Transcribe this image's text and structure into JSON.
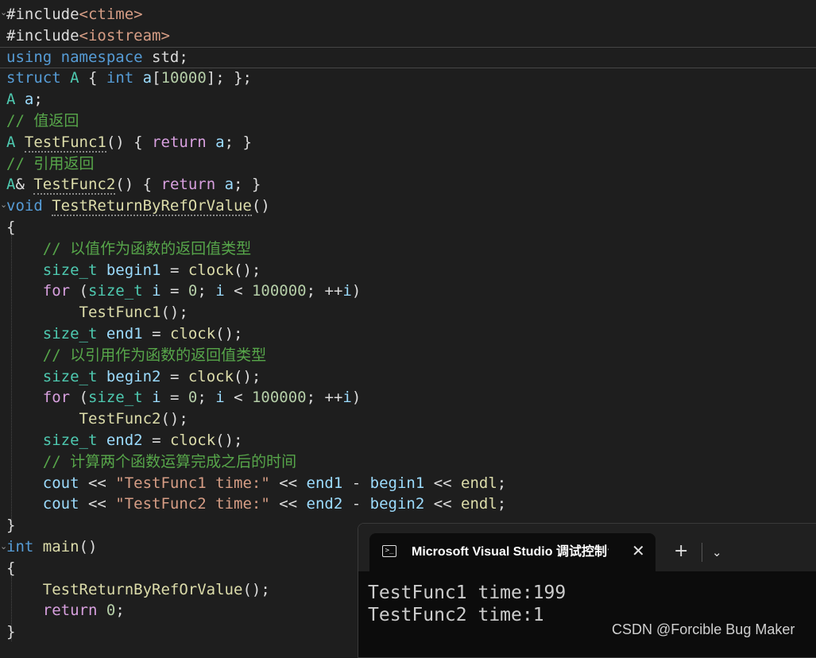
{
  "code": [
    {
      "t": [
        [
          "pl",
          "#include"
        ],
        [
          "str",
          "<ctime>"
        ]
      ]
    },
    {
      "t": [
        [
          "pl",
          "#include"
        ],
        [
          "str",
          "<iostream>"
        ]
      ]
    },
    {
      "t": [
        [
          "kw",
          "using"
        ],
        [
          "pl",
          " "
        ],
        [
          "kw",
          "namespace"
        ],
        [
          "pl",
          " std;"
        ]
      ]
    },
    {
      "t": [
        [
          "kw",
          "struct"
        ],
        [
          "pl",
          " "
        ],
        [
          "ty",
          "A"
        ],
        [
          "pl",
          " { "
        ],
        [
          "kw",
          "int"
        ],
        [
          "pl",
          " "
        ],
        [
          "var",
          "a"
        ],
        [
          "pl",
          "["
        ],
        [
          "num",
          "10000"
        ],
        [
          "pl",
          "]; };"
        ]
      ]
    },
    {
      "t": [
        [
          "ty",
          "A"
        ],
        [
          "pl",
          " "
        ],
        [
          "var",
          "a"
        ],
        [
          "pl",
          ";"
        ]
      ]
    },
    {
      "t": [
        [
          "cm",
          "// 值返回"
        ]
      ]
    },
    {
      "t": [
        [
          "ty",
          "A"
        ],
        [
          "pl",
          " "
        ],
        [
          "fn",
          "TestFunc1"
        ],
        [
          "pl",
          "() { "
        ],
        [
          "kwp",
          "return"
        ],
        [
          "pl",
          " "
        ],
        [
          "var",
          "a"
        ],
        [
          "pl",
          "; }"
        ]
      ]
    },
    {
      "t": [
        [
          "cm",
          "// 引用返回"
        ]
      ]
    },
    {
      "t": [
        [
          "ty",
          "A"
        ],
        [
          "pl",
          "& "
        ],
        [
          "fn",
          "TestFunc2"
        ],
        [
          "pl",
          "() { "
        ],
        [
          "kwp",
          "return"
        ],
        [
          "pl",
          " "
        ],
        [
          "var",
          "a"
        ],
        [
          "pl",
          "; }"
        ]
      ]
    },
    {
      "t": [
        [
          "kw",
          "void"
        ],
        [
          "pl",
          " "
        ],
        [
          "fn",
          "TestReturnByRefOrValue"
        ],
        [
          "pl",
          "()"
        ]
      ]
    },
    {
      "t": [
        [
          "pl",
          "{"
        ]
      ]
    },
    {
      "t": [
        [
          "pl",
          "    "
        ],
        [
          "cm",
          "// 以值作为函数的返回值类型"
        ]
      ]
    },
    {
      "t": [
        [
          "pl",
          "    "
        ],
        [
          "ty",
          "size_t"
        ],
        [
          "pl",
          " "
        ],
        [
          "var",
          "begin1"
        ],
        [
          "pl",
          " = "
        ],
        [
          "fn",
          "clock"
        ],
        [
          "pl",
          "();"
        ]
      ]
    },
    {
      "t": [
        [
          "pl",
          "    "
        ],
        [
          "kwp",
          "for"
        ],
        [
          "pl",
          " ("
        ],
        [
          "ty",
          "size_t"
        ],
        [
          "pl",
          " "
        ],
        [
          "var",
          "i"
        ],
        [
          "pl",
          " = "
        ],
        [
          "num",
          "0"
        ],
        [
          "pl",
          "; "
        ],
        [
          "var",
          "i"
        ],
        [
          "pl",
          " < "
        ],
        [
          "num",
          "100000"
        ],
        [
          "pl",
          "; ++"
        ],
        [
          "var",
          "i"
        ],
        [
          "pl",
          ")"
        ]
      ]
    },
    {
      "t": [
        [
          "pl",
          "        "
        ],
        [
          "fn",
          "TestFunc1"
        ],
        [
          "pl",
          "();"
        ]
      ]
    },
    {
      "t": [
        [
          "pl",
          "    "
        ],
        [
          "ty",
          "size_t"
        ],
        [
          "pl",
          " "
        ],
        [
          "var",
          "end1"
        ],
        [
          "pl",
          " = "
        ],
        [
          "fn",
          "clock"
        ],
        [
          "pl",
          "();"
        ]
      ]
    },
    {
      "t": [
        [
          "pl",
          "    "
        ],
        [
          "cm",
          "// 以引用作为函数的返回值类型"
        ]
      ]
    },
    {
      "t": [
        [
          "pl",
          "    "
        ],
        [
          "ty",
          "size_t"
        ],
        [
          "pl",
          " "
        ],
        [
          "var",
          "begin2"
        ],
        [
          "pl",
          " = "
        ],
        [
          "fn",
          "clock"
        ],
        [
          "pl",
          "();"
        ]
      ]
    },
    {
      "t": [
        [
          "pl",
          "    "
        ],
        [
          "kwp",
          "for"
        ],
        [
          "pl",
          " ("
        ],
        [
          "ty",
          "size_t"
        ],
        [
          "pl",
          " "
        ],
        [
          "var",
          "i"
        ],
        [
          "pl",
          " = "
        ],
        [
          "num",
          "0"
        ],
        [
          "pl",
          "; "
        ],
        [
          "var",
          "i"
        ],
        [
          "pl",
          " < "
        ],
        [
          "num",
          "100000"
        ],
        [
          "pl",
          "; ++"
        ],
        [
          "var",
          "i"
        ],
        [
          "pl",
          ")"
        ]
      ]
    },
    {
      "t": [
        [
          "pl",
          "        "
        ],
        [
          "fn",
          "TestFunc2"
        ],
        [
          "pl",
          "();"
        ]
      ]
    },
    {
      "t": [
        [
          "pl",
          "    "
        ],
        [
          "ty",
          "size_t"
        ],
        [
          "pl",
          " "
        ],
        [
          "var",
          "end2"
        ],
        [
          "pl",
          " = "
        ],
        [
          "fn",
          "clock"
        ],
        [
          "pl",
          "();"
        ]
      ]
    },
    {
      "t": [
        [
          "pl",
          "    "
        ],
        [
          "cm",
          "// 计算两个函数运算完成之后的时间"
        ]
      ]
    },
    {
      "t": [
        [
          "pl",
          "    "
        ],
        [
          "var",
          "cout"
        ],
        [
          "pl",
          " << "
        ],
        [
          "str",
          "\"TestFunc1 time:\""
        ],
        [
          "pl",
          " << "
        ],
        [
          "var",
          "end1"
        ],
        [
          "pl",
          " - "
        ],
        [
          "var",
          "begin1"
        ],
        [
          "pl",
          " << "
        ],
        [
          "fn",
          "endl"
        ],
        [
          "pl",
          ";"
        ]
      ]
    },
    {
      "t": [
        [
          "pl",
          "    "
        ],
        [
          "var",
          "cout"
        ],
        [
          "pl",
          " << "
        ],
        [
          "str",
          "\"TestFunc2 time:\""
        ],
        [
          "pl",
          " << "
        ],
        [
          "var",
          "end2"
        ],
        [
          "pl",
          " - "
        ],
        [
          "var",
          "begin2"
        ],
        [
          "pl",
          " << "
        ],
        [
          "fn",
          "endl"
        ],
        [
          "pl",
          ";"
        ]
      ]
    },
    {
      "t": [
        [
          "pl",
          "}"
        ]
      ]
    },
    {
      "t": [
        [
          "kw",
          "int"
        ],
        [
          "pl",
          " "
        ],
        [
          "fn",
          "main"
        ],
        [
          "pl",
          "()"
        ]
      ]
    },
    {
      "t": [
        [
          "pl",
          "{"
        ]
      ]
    },
    {
      "t": [
        [
          "pl",
          "    "
        ],
        [
          "fn",
          "TestReturnByRefOrValue"
        ],
        [
          "pl",
          "();"
        ]
      ]
    },
    {
      "t": [
        [
          "pl",
          "    "
        ],
        [
          "kwp",
          "return"
        ],
        [
          "pl",
          " "
        ],
        [
          "num",
          "0"
        ],
        [
          "pl",
          ";"
        ]
      ]
    },
    {
      "t": [
        [
          "pl",
          "}"
        ]
      ]
    }
  ],
  "console": {
    "title": "Microsoft Visual Studio 调试控制台",
    "icon": "terminal-icon",
    "close_glyph": "✕",
    "new_tab_glyph": "+",
    "dropdown_glyph": "⌄",
    "output": [
      "TestFunc1 time:199",
      "TestFunc2 time:1"
    ]
  },
  "watermark": "CSDN @Forcible Bug Maker"
}
